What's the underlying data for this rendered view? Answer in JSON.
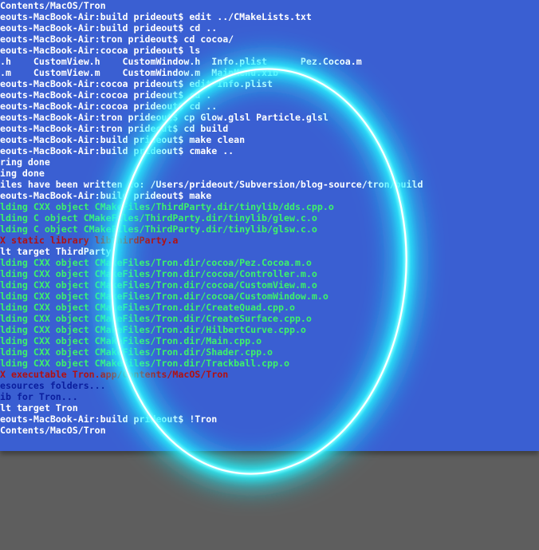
{
  "terminal": {
    "lines": [
      {
        "text": "Contents/MacOS/Tron",
        "color": "#ffffff"
      },
      {
        "text": "eouts-MacBook-Air:build prideout$ edit ../CMakeLists.txt",
        "color": "#ffffff"
      },
      {
        "text": "eouts-MacBook-Air:build prideout$ cd ..",
        "color": "#ffffff"
      },
      {
        "text": "eouts-MacBook-Air:tron prideout$ cd cocoa/",
        "color": "#ffffff"
      },
      {
        "text": "eouts-MacBook-Air:cocoa prideout$ ls",
        "color": "#ffffff"
      },
      {
        "text": ".h    CustomView.h    CustomWindow.h  Info.plist      Pez.Cocoa.m",
        "color": "#ffffff"
      },
      {
        "text": ".m    CustomView.m    CustomWindow.m  MainMenu.xib",
        "color": "#ffffff"
      },
      {
        "text": "eouts-MacBook-Air:cocoa prideout$ edit Info.plist",
        "color": "#ffffff"
      },
      {
        "text": "eouts-MacBook-Air:cocoa prideout$ cd .",
        "color": "#ffffff"
      },
      {
        "text": "eouts-MacBook-Air:cocoa prideout$ cd ..",
        "color": "#ffffff"
      },
      {
        "text": "eouts-MacBook-Air:tron prideout$ cp Glow.glsl Particle.glsl",
        "color": "#ffffff"
      },
      {
        "text": "eouts-MacBook-Air:tron prideout$ cd build",
        "color": "#ffffff"
      },
      {
        "text": "eouts-MacBook-Air:build prideout$ make clean",
        "color": "#ffffff"
      },
      {
        "text": "eouts-MacBook-Air:build prideout$ cmake ..",
        "color": "#ffffff"
      },
      {
        "text": "ring done",
        "color": "#ffffff"
      },
      {
        "text": "ing done",
        "color": "#ffffff"
      },
      {
        "text": "iles have been written to: /Users/prideout/Subversion/blog-source/tron/build",
        "color": "#ffffff"
      },
      {
        "text": "eouts-MacBook-Air:build prideout$ make",
        "color": "#ffffff"
      },
      {
        "text": "lding CXX object CMakeFiles/ThirdParty.dir/tinylib/dds.cpp.o",
        "color": "#3df26a"
      },
      {
        "text": "lding C object CMakeFiles/ThirdParty.dir/tinylib/glew.c.o",
        "color": "#3df26a"
      },
      {
        "text": "lding C object CMakeFiles/ThirdParty.dir/tinylib/glsw.c.o",
        "color": "#3df26a"
      },
      {
        "text": "X static library libThirdParty.a",
        "color": "#b31010"
      },
      {
        "text": "lt target ThirdParty",
        "color": "#ffffff"
      },
      {
        "text": "lding CXX object CMakeFiles/Tron.dir/cocoa/Pez.Cocoa.m.o",
        "color": "#3df26a"
      },
      {
        "text": "lding CXX object CMakeFiles/Tron.dir/cocoa/Controller.m.o",
        "color": "#3df26a"
      },
      {
        "text": "lding CXX object CMakeFiles/Tron.dir/cocoa/CustomView.m.o",
        "color": "#3df26a"
      },
      {
        "text": "lding CXX object CMakeFiles/Tron.dir/cocoa/CustomWindow.m.o",
        "color": "#3df26a"
      },
      {
        "text": "lding CXX object CMakeFiles/Tron.dir/CreateQuad.cpp.o",
        "color": "#3df26a"
      },
      {
        "text": "lding CXX object CMakeFiles/Tron.dir/CreateSurface.cpp.o",
        "color": "#3df26a"
      },
      {
        "text": "lding CXX object CMakeFiles/Tron.dir/HilbertCurve.cpp.o",
        "color": "#3df26a"
      },
      {
        "text": "lding CXX object CMakeFiles/Tron.dir/Main.cpp.o",
        "color": "#3df26a"
      },
      {
        "text": "lding CXX object CMakeFiles/Tron.dir/Shader.cpp.o",
        "color": "#3df26a"
      },
      {
        "text": "lding CXX object CMakeFiles/Tron.dir/Trackball.cpp.o",
        "color": "#3df26a"
      },
      {
        "text": "X executable Tron.app/Contents/MacOS/Tron",
        "color": "#b31010"
      },
      {
        "text": "esources folders...",
        "color": "#0a1e9e"
      },
      {
        "text": "ib for Tron...",
        "color": "#0a1e9e"
      },
      {
        "text": "lt target Tron",
        "color": "#ffffff"
      },
      {
        "text": "eouts-MacBook-Air:build prideout$ !Tron",
        "color": "#ffffff"
      },
      {
        "text": "Contents/MacOS/Tron",
        "color": "#ffffff"
      }
    ]
  },
  "colors": {
    "terminal_background": "#3a5fd2",
    "desktop_background": "#5e5e5e",
    "glow": "#1ef0ff",
    "glow_core": "#ffffff"
  }
}
